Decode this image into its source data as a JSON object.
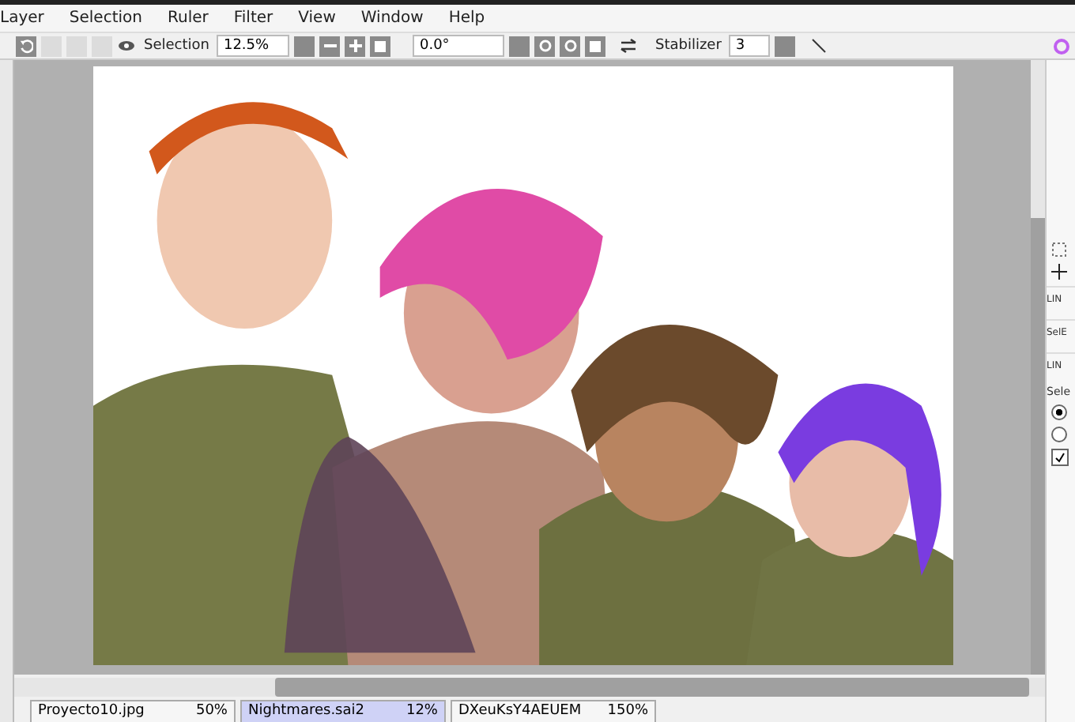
{
  "menu": [
    "Layer",
    "Selection",
    "Ruler",
    "Filter",
    "View",
    "Window",
    "Help"
  ],
  "toolbar": {
    "view_label": "Selection",
    "zoom": "12.5%",
    "angle": "0.0°",
    "stabilizer_label": "Stabilizer",
    "stabilizer": "3"
  },
  "right_panel": {
    "rows": [
      "LIN",
      "SelE",
      "LIN"
    ],
    "section": "Sele",
    "options": [
      {
        "selected": true
      },
      {
        "selected": false
      }
    ],
    "checkbox": {
      "checked": true
    }
  },
  "tabs": [
    {
      "name": "Proyecto10.jpg",
      "zoom": "50%",
      "selected": false
    },
    {
      "name": "Nightmares.sai2",
      "zoom": "12%",
      "selected": true
    },
    {
      "name": "DXeuKsY4AEUEM",
      "zoom": "150%",
      "selected": false
    }
  ]
}
